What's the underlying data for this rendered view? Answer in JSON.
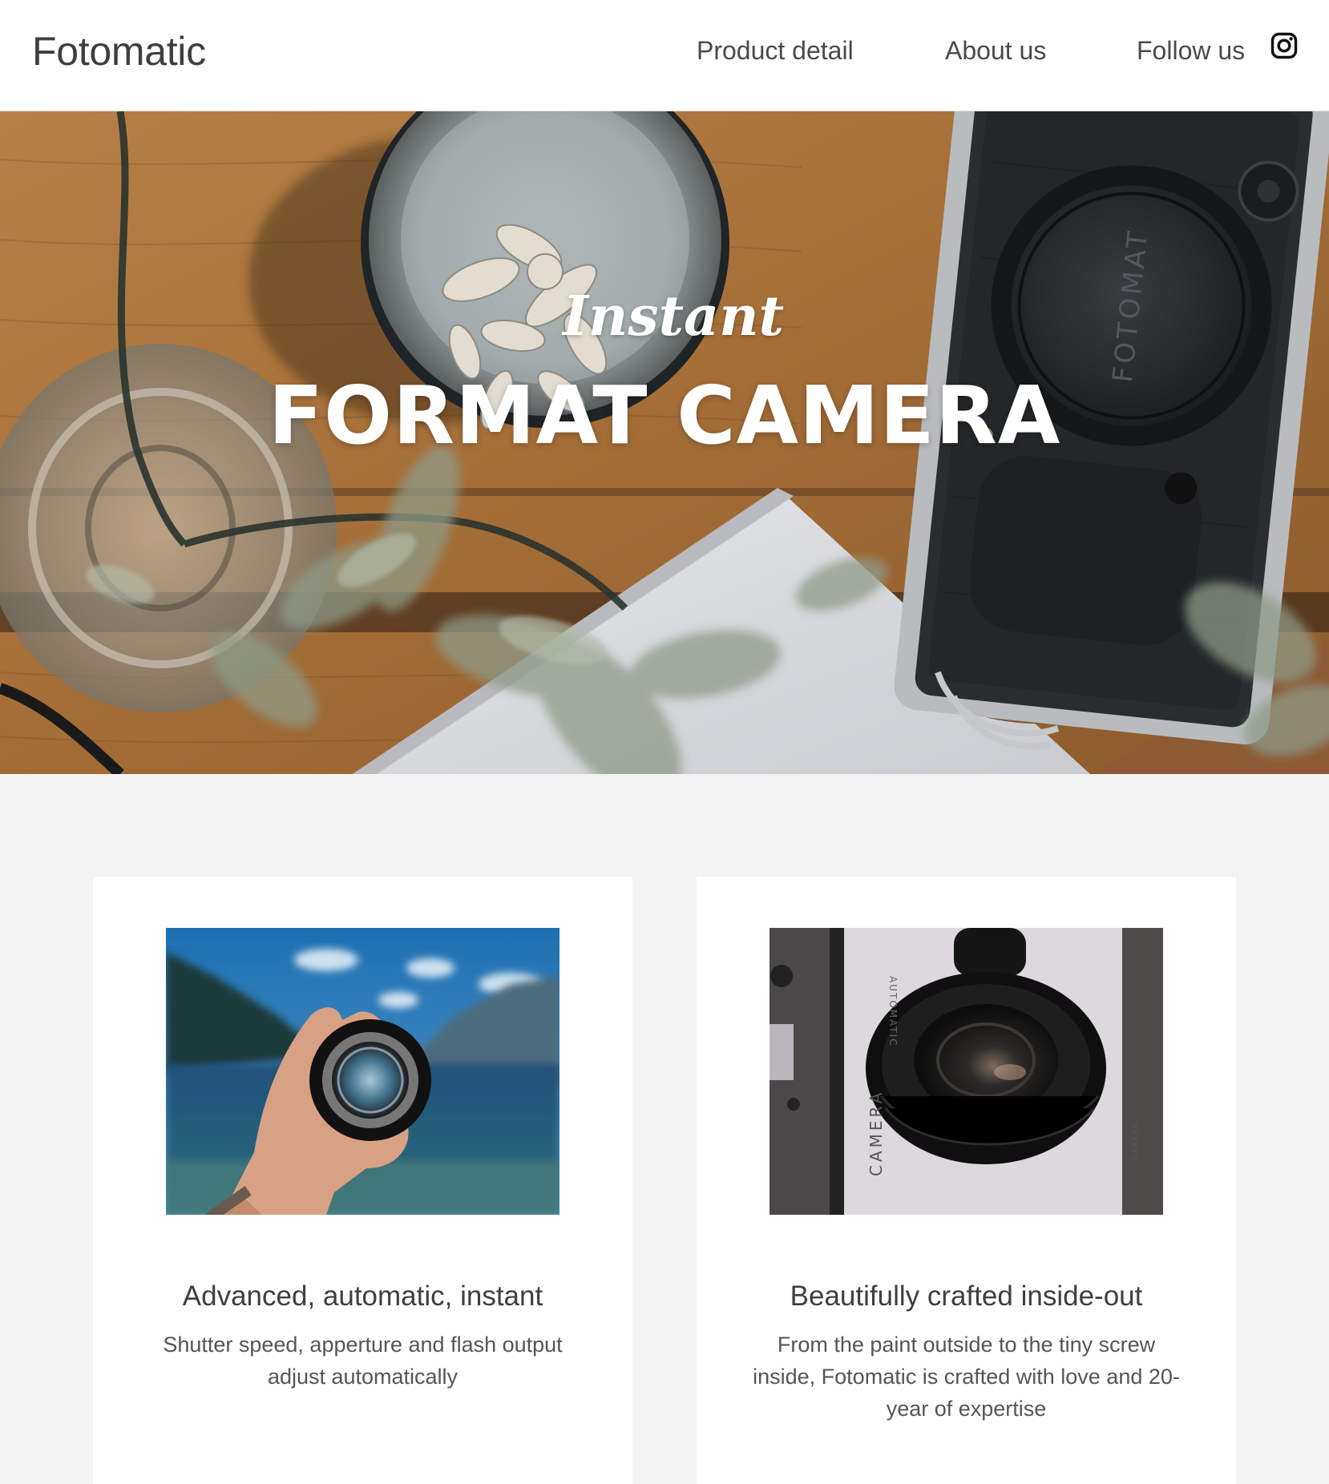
{
  "header": {
    "brand": "Fotomatic",
    "nav": {
      "product_detail": "Product detail",
      "about_us": "About us",
      "follow_us": "Follow us"
    },
    "social_icon": "instagram-icon"
  },
  "hero": {
    "script_text": "Instant",
    "title": "FORMAT CAMERA"
  },
  "features": [
    {
      "title": "Advanced, automatic, instant",
      "description": "Shutter speed, apperture and flash output adjust automatically"
    },
    {
      "title": "Beautifully crafted inside-out",
      "description": "From the paint outside to the tiny screw inside, Fotomatic is crafted with love and 20-year of expertise"
    }
  ]
}
